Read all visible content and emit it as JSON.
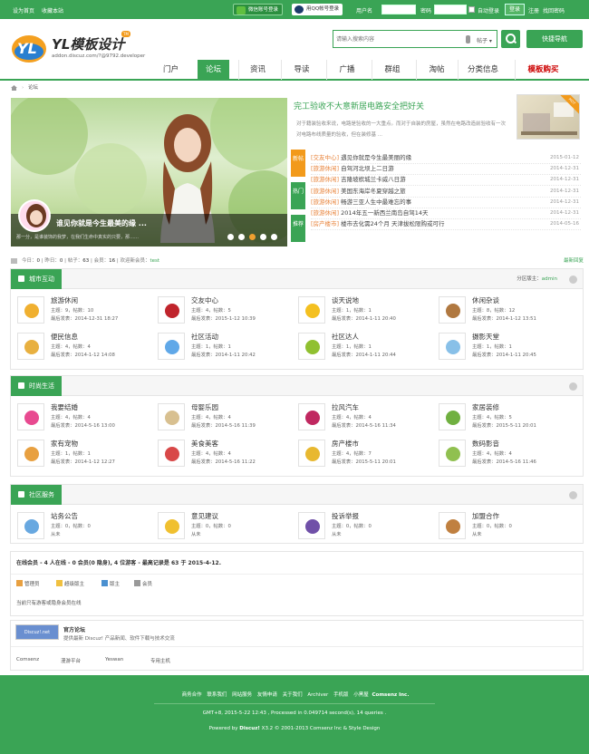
{
  "topbar": {
    "set_home": "设为首页",
    "bookmark": "收藏本站",
    "wechat_login": "微信账号登录",
    "qq_login": "用QQ帐号登录",
    "username_label": "用户名",
    "password_label": "密码",
    "remember": "自动登录",
    "login_btn": "登录",
    "register": "注册",
    "forgot": "找回密码"
  },
  "header": {
    "logo_title": "YL模板设计",
    "logo_tm": "TM",
    "logo_sub": "addon.discuz.com/?@9792.developer",
    "search_placeholder": "请输入搜索内容",
    "search_type": "帖子",
    "quick_nav": "快捷导航"
  },
  "nav": [
    "门户",
    "论坛",
    "资讯",
    "导读",
    "广播",
    "群组",
    "淘帖",
    "分类信息",
    "模板购买"
  ],
  "breadcrumb": {
    "arrow": "›",
    "current": "论坛"
  },
  "slider": {
    "title": "谁见你就是今生最美的缘 ...",
    "desc": "那一分，是谁装饰的我梦，在我们生命中真实的只要，那……",
    "dots": 5,
    "active_dot": 2
  },
  "feature": {
    "title": "完工验收不大意新居电路安全把好关",
    "desc": "对于籍装验收来说，电路是验收的一大重点。而对于自装的房屋，虽然在电路改造前验收有一次对电路布线质量的验收，但在装修基 ...",
    "badge": "HOT"
  },
  "vtabs": [
    "新帖",
    "热门",
    "推荐"
  ],
  "latest": [
    {
      "cat": "[交友中心]",
      "title": "遇见你就是今生最美丽的缘",
      "date": "2015-01-12"
    },
    {
      "cat": "[旅游休闲]",
      "title": "自驾河北坝上二日游",
      "date": "2014-12-31"
    },
    {
      "cat": "[旅游休闲]",
      "title": "吉隆坡槟城兰卡威八日游",
      "date": "2014-12-31"
    },
    {
      "cat": "[旅游休闲]",
      "title": "美国东海岸冬夏穿越之旅",
      "date": "2014-12-31"
    },
    {
      "cat": "[旅游休闲]",
      "title": "畅游三亚人生中最难忘的事",
      "date": "2014-12-31"
    },
    {
      "cat": "[旅游休闲]",
      "title": "2014年五一新西兰南岛自驾14天",
      "date": "2014-12-31"
    },
    {
      "cat": "[房产楼市]",
      "title": "楼市去化需24个月 天津拔松限购或可行",
      "date": "2014-05-16"
    }
  ],
  "stats": {
    "today_l": "今日：",
    "today": "0",
    "yesterday_l": "昨日：",
    "yesterday": "0",
    "posts_l": "帖子：",
    "posts": "63",
    "members_l": "会员：",
    "members": "16",
    "newest_l": "欢迎新会员：",
    "newest": "test",
    "latest_reply": "最新回复"
  },
  "sections": [
    {
      "title": "城市互动",
      "moderator_label": "分区版主：",
      "moderator": "admin",
      "forums": [
        {
          "name": "旅游休闲",
          "l1": "主题：9，帖数：10",
          "l2": "最后发表：2014-12-31 18:27",
          "color": "#f0b030"
        },
        {
          "name": "交友中心",
          "l1": "主题：4，帖数：5",
          "l2": "最后发表：2015-1-12 10:39",
          "color": "#c0242c"
        },
        {
          "name": "谈天说地",
          "l1": "主题：1，帖数：1",
          "l2": "最后发表：2014-1-11 20:40",
          "color": "#f4c020"
        },
        {
          "name": "休闲杂谈",
          "l1": "主题：8，帖数：12",
          "l2": "最后发表：2014-1-12 13:51",
          "color": "#b07840"
        },
        {
          "name": "便民信息",
          "l1": "主题：4，帖数：4",
          "l2": "最后发表：2014-1-12 14:08",
          "color": "#e8b040"
        },
        {
          "name": "社区活动",
          "l1": "主题：1，帖数：1",
          "l2": "最后发表：2014-1-11 20:42",
          "color": "#60a8e8"
        },
        {
          "name": "社区达人",
          "l1": "主题：1，帖数：1",
          "l2": "最后发表：2014-1-11 20:44",
          "color": "#90c030"
        },
        {
          "name": "摄影天堂",
          "l1": "主题：1，帖数：1",
          "l2": "最后发表：2014-1-11 20:45",
          "color": "#88c0e8"
        }
      ]
    },
    {
      "title": "时尚生活",
      "forums": [
        {
          "name": "我要结婚",
          "l1": "主题：4，帖数：4",
          "l2": "最后发表：2014-5-16 13:00",
          "color": "#e84a90"
        },
        {
          "name": "母婴乐园",
          "l1": "主题：4，帖数：4",
          "l2": "最后发表：2014-5-16 11:39",
          "color": "#d8c090"
        },
        {
          "name": "拉风汽车",
          "l1": "主题：4，帖数：4",
          "l2": "最后发表：2014-5-16 11:34",
          "color": "#c02860"
        },
        {
          "name": "家居装修",
          "l1": "主题：4，帖数：5",
          "l2": "最后发表：2015-5-11 20:01",
          "color": "#70b040"
        },
        {
          "name": "家有宠物",
          "l1": "主题：1，帖数：1",
          "l2": "最后发表：2014-1-12 12:27",
          "color": "#e8a040"
        },
        {
          "name": "美食美客",
          "l1": "主题：4，帖数：4",
          "l2": "最后发表：2014-5-16 11:22",
          "color": "#d84848"
        },
        {
          "name": "房产楼市",
          "l1": "主题：4，帖数：7",
          "l2": "最后发表：2015-5-11 20:01",
          "color": "#e8b830"
        },
        {
          "name": "数码影音",
          "l1": "主题：4，帖数：4",
          "l2": "最后发表：2014-5-16 11:46",
          "color": "#90c050"
        }
      ]
    },
    {
      "title": "社区服务",
      "forums": [
        {
          "name": "站务公告",
          "l1": "主题：0，帖数：0",
          "l2": "从未",
          "color": "#68a8e0"
        },
        {
          "name": "意见建议",
          "l1": "主题：0，帖数：0",
          "l2": "从未",
          "color": "#f0c030"
        },
        {
          "name": "投诉举报",
          "l1": "主题：0，帖数：0",
          "l2": "从未",
          "color": "#7050a8"
        },
        {
          "name": "加盟合作",
          "l1": "主题：0，帖数：0",
          "l2": "从未",
          "color": "#c08040"
        }
      ]
    }
  ],
  "online": {
    "header": "在线会员 - 4 人在线 - 0 会员(0 隐身), 4 位游客 - 最高记录是 63 于 2015-4-12.",
    "legend": [
      {
        "label": "管理员",
        "color": "#e8a040"
      },
      {
        "label": "超级版主",
        "color": "#f0c040"
      },
      {
        "label": "版主",
        "color": "#4a90d0"
      },
      {
        "label": "会员",
        "color": "#999999"
      }
    ],
    "nobody": "当前只有游客或隐身会员在线"
  },
  "links": {
    "logo_text": "Discuz!.net",
    "title": "官方论坛",
    "desc": "提供最新 Discuz! 产品新闻、软件下载与技术交流",
    "items": [
      "Comsenz",
      "漫游平台",
      "Yeswan",
      "专用主机"
    ]
  },
  "footer": {
    "nav": [
      "商务合作",
      "联系我们",
      "网站服务",
      "友情申请",
      "关于我们",
      "Archiver",
      "手机版",
      "小黑屋",
      "Comsenz Inc."
    ],
    "line2": "GMT+8, 2015-5-22 12:43 , Processed in 0.049714 second(s), 14 queries .",
    "powered": "Powered by",
    "dz": "Discuz!",
    "copy": "X3.2 © 2001-2013 Comsenz Inc & Style Design"
  }
}
